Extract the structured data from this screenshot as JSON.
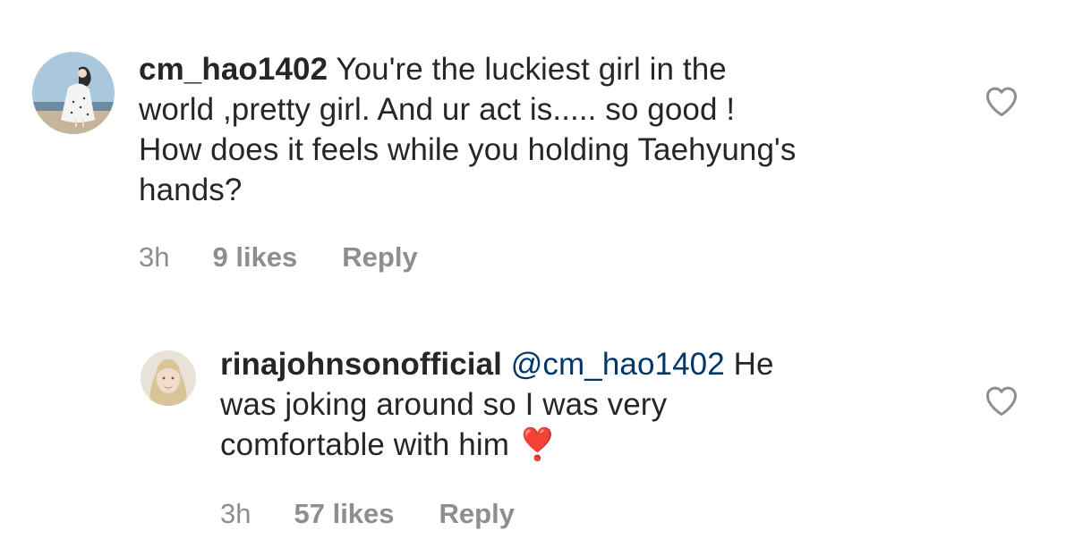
{
  "comments": [
    {
      "username": "cm_hao1402",
      "text_lines": [
        "You're the luckiest girl in the",
        "world ,pretty girl. And ur act is..... so good !",
        "How does it feels while you holding Taehyung's",
        "hands?"
      ],
      "time": "3h",
      "likes": "9 likes",
      "reply_label": "Reply",
      "avatar_icon": "illustrated-woman-avatar",
      "like_icon": "heart-outline-icon"
    },
    {
      "username": "rinajohnsonofficial",
      "mention": "@cm_hao1402",
      "text_lines": [
        "He",
        "was joking around so I was very",
        "comfortable with him"
      ],
      "emoji": "❣️",
      "time": "3h",
      "likes": "57 likes",
      "reply_label": "Reply",
      "avatar_icon": "profile-photo-avatar",
      "like_icon": "heart-outline-icon"
    }
  ],
  "colors": {
    "text": "#262626",
    "meta": "#8e8e8e",
    "mention": "#00376b",
    "heart_emoji": "#ed4956",
    "like_icon": "#8e8e8e"
  }
}
